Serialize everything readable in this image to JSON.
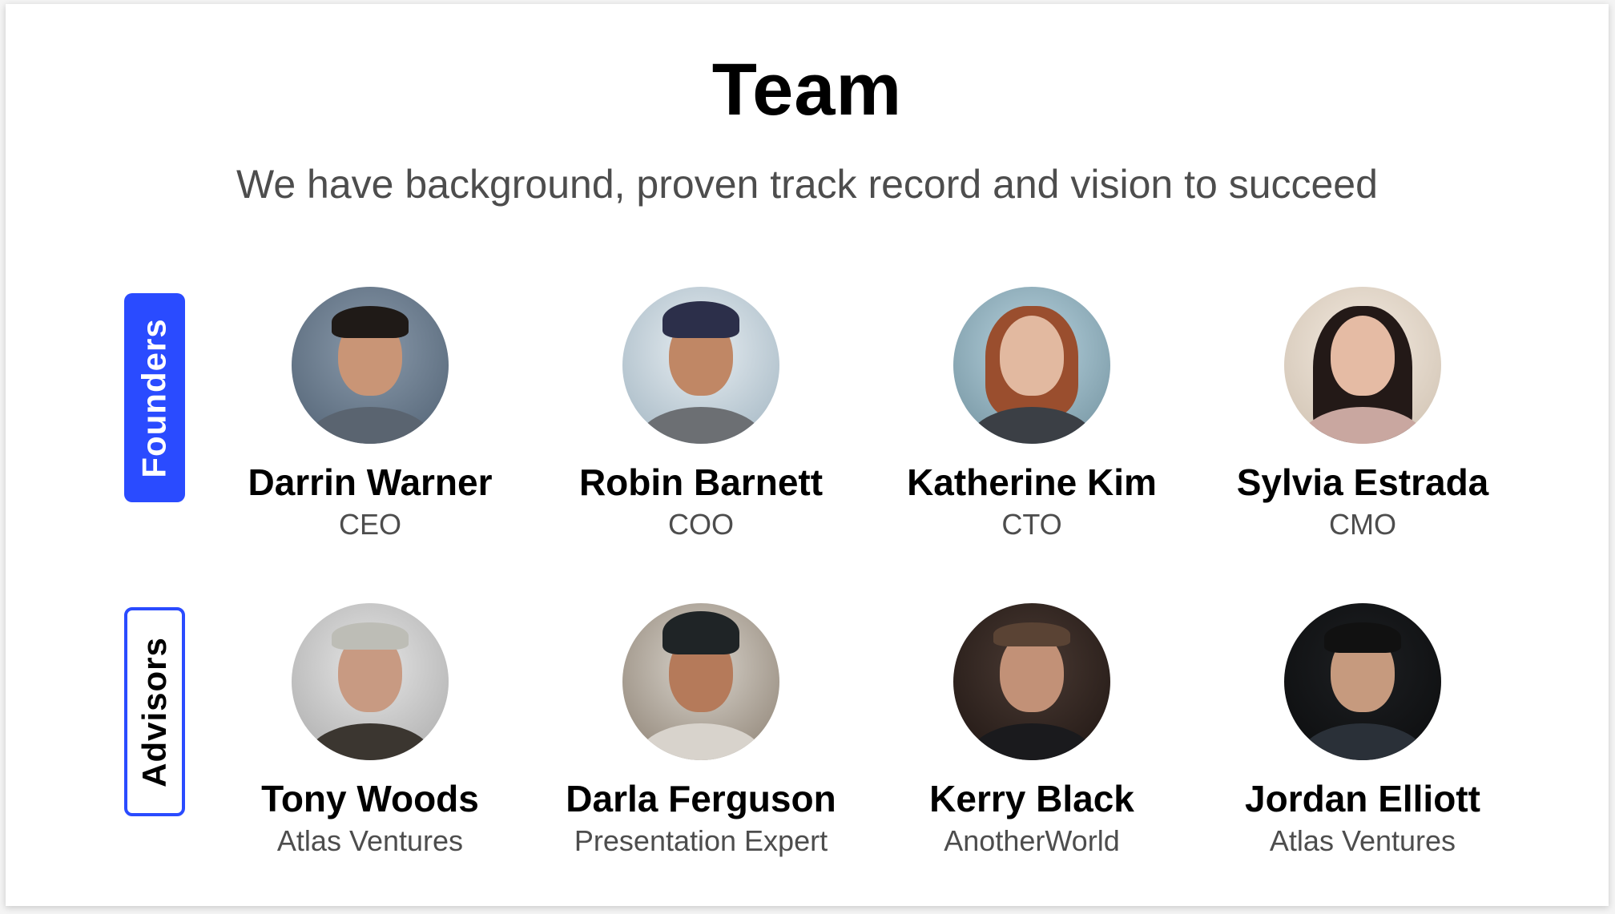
{
  "header": {
    "title": "Team",
    "subtitle": "We have background, proven track record and vision to succeed"
  },
  "colors": {
    "accent": "#2a4bff",
    "title_text": "#000000",
    "subtitle_text": "#4d4d4d"
  },
  "groups": [
    {
      "label": "Founders",
      "style": "filled",
      "members": [
        {
          "name": "Darrin Warner",
          "role": "CEO",
          "avatar": "photo-man-dark-hair"
        },
        {
          "name": "Robin Barnett",
          "role": "COO",
          "avatar": "photo-man-cap"
        },
        {
          "name": "Katherine Kim",
          "role": "CTO",
          "avatar": "photo-woman-red-hair"
        },
        {
          "name": "Sylvia Estrada",
          "role": "CMO",
          "avatar": "photo-woman-dark-hair"
        }
      ]
    },
    {
      "label": "Advisors",
      "style": "outlined",
      "members": [
        {
          "name": "Tony Woods",
          "role": "Atlas Ventures",
          "avatar": "photo-man-glasses"
        },
        {
          "name": "Darla Ferguson",
          "role": "Presentation Expert",
          "avatar": "photo-woman-glasses"
        },
        {
          "name": "Kerry Black",
          "role": "AnotherWorld",
          "avatar": "photo-man-suit"
        },
        {
          "name": "Jordan Elliott",
          "role": "Atlas Ventures",
          "avatar": "photo-man-dark-background"
        }
      ]
    }
  ]
}
